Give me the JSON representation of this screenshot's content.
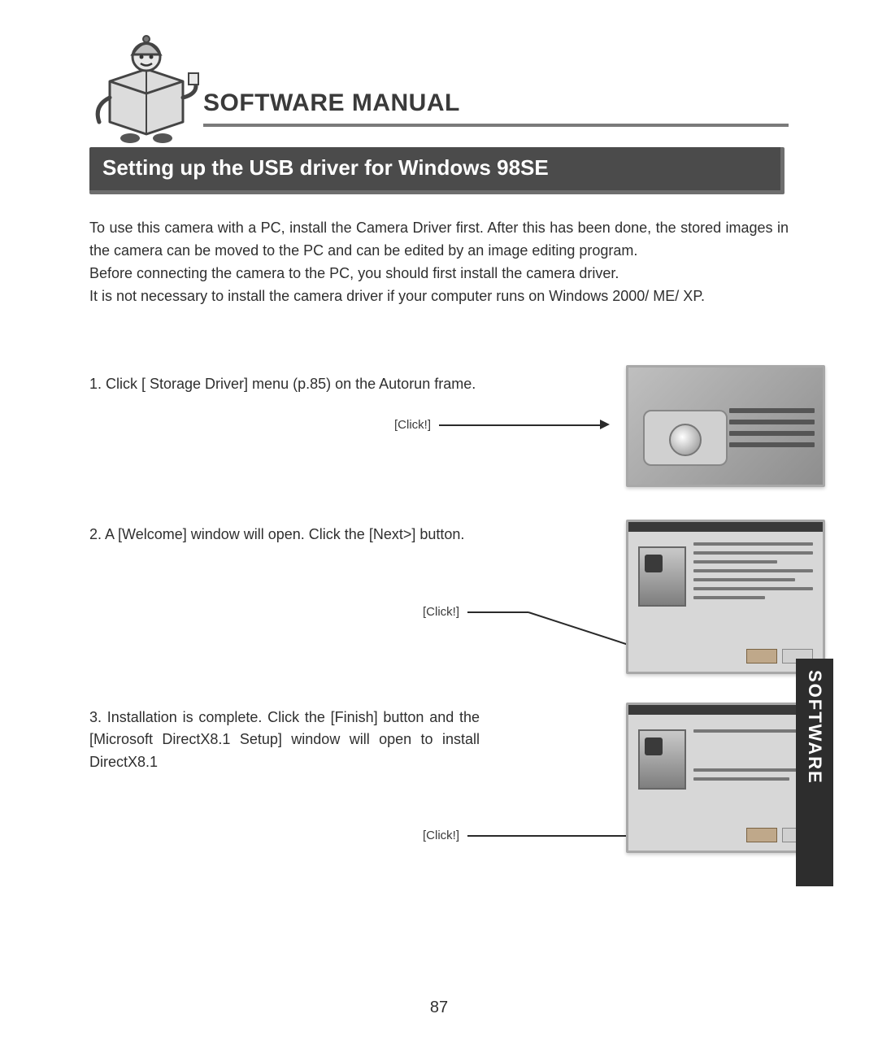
{
  "header": {
    "title": "SOFTWARE MANUAL"
  },
  "section": {
    "heading": "Setting up the USB driver for Windows 98SE"
  },
  "intro": {
    "p1": "To use this camera with a PC, install the Camera Driver first. After this has been done, the stored images in the camera can be moved to the PC and can be edited by an image editing program.",
    "p2": "Before connecting the camera to the PC, you should first install the camera driver.",
    "p3": "It is not necessary to install the camera driver if your computer runs on Windows 2000/ ME/ XP."
  },
  "steps": {
    "s1": {
      "text": "1. Click [ Storage Driver] menu (p.85) on the Autorun frame.",
      "click": "[Click!]"
    },
    "s2": {
      "text": "2. A [Welcome] window will open. Click the [Next>] button.",
      "click": "[Click!]"
    },
    "s3": {
      "text": "3. Installation is complete. Click the [Finish] button and the [Microsoft DirectX8.1 Setup] window will open to install DirectX8.1",
      "click": "[Click!]"
    }
  },
  "side_tab": "SOFTWARE",
  "page_number": "87"
}
